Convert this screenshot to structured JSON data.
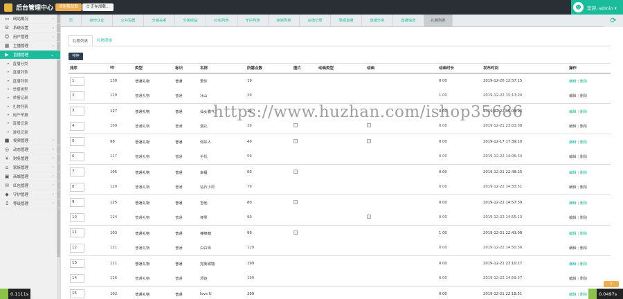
{
  "header": {
    "brand": "后台管理中心",
    "btn_primary": "请用我就管",
    "btn_secondary": "正在加载...",
    "user_label": "欢迎, admin ▾"
  },
  "sidebar": {
    "items_top": [
      {
        "label": "网站概况",
        "icon": "monitor-icon"
      },
      {
        "label": "系统设置",
        "icon": "gear-icon"
      },
      {
        "label": "用户管理",
        "icon": "user-icon"
      },
      {
        "label": "主播管理",
        "icon": "film-icon"
      },
      {
        "label": "直播管理",
        "icon": "play-icon",
        "active": true
      }
    ],
    "sub_items": [
      "直播分类",
      "直播列表",
      "直播列表",
      "举报类型",
      "举报记录",
      "礼物列表",
      "用户举报",
      "直播记录",
      "游戏记录"
    ],
    "items_bottom": [
      {
        "label": "视频管理",
        "icon": "video-icon"
      },
      {
        "label": "动态管理",
        "icon": "circle-icon"
      },
      {
        "label": "财务管理",
        "icon": "money-icon"
      },
      {
        "label": "家族管理",
        "icon": "bank-icon"
      },
      {
        "label": "商城管理",
        "icon": "shop-icon"
      },
      {
        "label": "红包管理",
        "icon": "envelope-icon"
      },
      {
        "label": "守护管理",
        "icon": "shield-icon"
      },
      {
        "label": "等级管理",
        "icon": "level-icon"
      }
    ]
  },
  "tabs": [
    "页",
    "身份认证",
    "公共设置",
    "分销关系",
    "分销收益",
    "红包列表",
    "守护列表",
    "家族列表",
    "充值记录",
    "录视直播",
    "直播分类",
    "直播信息",
    "礼物列表"
  ],
  "active_tab_index": 12,
  "subtabs": [
    "礼物列表",
    "礼物添加"
  ],
  "sort_button": "排序",
  "watermark": "https://www.huzhan.com/ishop35686",
  "table": {
    "headers": [
      "排序",
      "ID",
      "类型",
      "标识",
      "名称",
      "所需点数",
      "图片",
      "动画类型",
      "动画",
      "动画时长",
      "发布时间",
      "操作"
    ],
    "rows": [
      {
        "sort": "1",
        "id": "130",
        "type": "普通礼物",
        "mark": "普通",
        "name": "爱你",
        "price": "19",
        "img": false,
        "anim_type": "",
        "anim": false,
        "duration": "0.00",
        "time": "2019-12-26 12:57:15",
        "op": [
          "编辑",
          "删除"
        ]
      },
      {
        "sort": "2",
        "id": "129",
        "type": "普通礼物",
        "mark": "普通",
        "name": "冰山",
        "price": "29",
        "img": false,
        "anim_type": "",
        "anim": false,
        "duration": "1.00",
        "time": "2019-12-22 15:13:20",
        "op": [
          "编辑",
          "删除"
        ]
      },
      {
        "sort": "3",
        "id": "127",
        "type": "普通礼物",
        "mark": "普通",
        "name": "仙女霸气",
        "price": "29",
        "img": false,
        "anim_type": "",
        "anim": false,
        "duration": "0.00",
        "time": "2019-12-22 15:03:03",
        "op": [
          "编辑",
          "删除"
        ]
      },
      {
        "sort": "4",
        "id": "109",
        "type": "普通礼物",
        "mark": "普通",
        "name": "烟花",
        "price": "39",
        "img": true,
        "anim_type": "",
        "anim": true,
        "duration": "0.00",
        "time": "2019-12-21 23:03:38",
        "op": [
          "编辑",
          "删除"
        ]
      },
      {
        "sort": "5",
        "id": "98",
        "type": "普通礼物",
        "mark": "普通",
        "name": "你好人",
        "price": "40",
        "img": true,
        "anim_type": "",
        "anim": true,
        "duration": "0.00",
        "time": "2019-12-17 17:39:10",
        "op": [
          "编辑",
          "删除"
        ]
      },
      {
        "sort": "6",
        "id": "117",
        "type": "普通礼物",
        "mark": "普通",
        "name": "手机",
        "price": "59",
        "img": false,
        "anim_type": "",
        "anim": false,
        "duration": "0.00",
        "time": "2019-12-22 14:06:34",
        "op": [
          "编辑",
          "删除"
        ]
      },
      {
        "sort": "7",
        "id": "105",
        "type": "普通礼物",
        "mark": "普通",
        "name": "幸福",
        "price": "60",
        "img": true,
        "anim_type": "",
        "anim": false,
        "duration": "0.00",
        "time": "2019-12-21 22:48:25",
        "op": [
          "编辑",
          "删除"
        ]
      },
      {
        "sort": "8",
        "id": "120",
        "type": "普通礼物",
        "mark": "普通",
        "name": "钻石小财",
        "price": "79",
        "img": false,
        "anim_type": "",
        "anim": false,
        "duration": "0.00",
        "time": "2019-12-22 14:33:51",
        "op": [
          "编辑",
          "删除"
        ]
      },
      {
        "sort": "9",
        "id": "125",
        "type": "普通礼物",
        "mark": "普通",
        "name": "吉他",
        "price": "80",
        "img": true,
        "anim_type": "",
        "anim": false,
        "duration": "0.00",
        "time": "2019-12-22 14:57:39",
        "op": [
          "编辑",
          "删除"
        ]
      },
      {
        "sort": "10",
        "id": "124",
        "type": "普通礼物",
        "mark": "普通",
        "name": "棒果",
        "price": "99",
        "img": false,
        "anim_type": "",
        "anim": true,
        "duration": "0.00",
        "time": "2019-12-22 14:55:13",
        "op": [
          "编辑",
          "删除"
        ]
      },
      {
        "sort": "11",
        "id": "103",
        "type": "普通礼物",
        "mark": "普通",
        "name": "棒棒糖",
        "price": "99",
        "img": true,
        "anim_type": "",
        "anim": false,
        "duration": "1.00",
        "time": "2019-12-21 22:43:08",
        "op": [
          "编辑",
          "删除"
        ]
      },
      {
        "sort": "12",
        "id": "121",
        "type": "普通礼物",
        "mark": "普通",
        "name": "白白辉",
        "price": "129",
        "img": false,
        "anim_type": "",
        "anim": false,
        "duration": "0.00",
        "time": "2019-12-22 14:50:36",
        "op": [
          "编辑",
          "删除"
        ]
      },
      {
        "sort": "13",
        "id": "111",
        "type": "普通礼物",
        "mark": "普通",
        "name": "完美城墙",
        "price": "199",
        "img": false,
        "anim_type": "",
        "anim": false,
        "duration": "0.00",
        "time": "2019-12-21 23:10:17",
        "op": [
          "编辑",
          "删除"
        ]
      },
      {
        "sort": "14",
        "id": "126",
        "type": "普通礼物",
        "mark": "普通",
        "name": "项链",
        "price": "199",
        "img": false,
        "anim_type": "",
        "anim": false,
        "duration": "0.00",
        "time": "2019-12-22 14:59:37",
        "op": [
          "编辑",
          "删除"
        ]
      },
      {
        "sort": "15",
        "id": "102",
        "type": "普通礼物",
        "mark": "普通",
        "name": "love U",
        "price": "299",
        "img": false,
        "anim_type": "",
        "anim": false,
        "duration": "0.00",
        "time": "2019-12-21 22:18:51",
        "op": [
          "编辑",
          "删除"
        ]
      }
    ]
  },
  "badges": {
    "left": "0.1111s",
    "right": "0.0497s"
  },
  "colors": {
    "accent": "#1abc9c",
    "topbar": "#2a2f36",
    "warning": "#f0ad4e"
  }
}
